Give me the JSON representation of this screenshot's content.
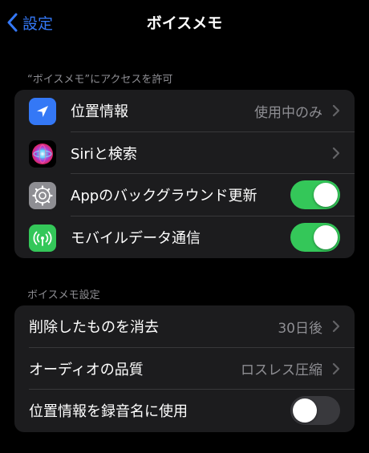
{
  "nav": {
    "back_label": "設定",
    "title": "ボイスメモ"
  },
  "section1": {
    "header": "“ボイスメモ”にアクセスを許可",
    "rows": [
      {
        "label": "位置情報",
        "value": "使用中のみ",
        "icon": "location-arrow-icon",
        "icon_color": "#3478f6",
        "control": "chevron"
      },
      {
        "label": "Siriと検索",
        "value": "",
        "icon": "siri-icon",
        "icon_color": "#000000",
        "control": "chevron"
      },
      {
        "label": "Appのバックグラウンド更新",
        "icon": "gear-icon",
        "icon_color": "#8e8e93",
        "control": "toggle",
        "toggle_on": true
      },
      {
        "label": "モバイルデータ通信",
        "icon": "cellular-antenna-icon",
        "icon_color": "#34c759",
        "control": "toggle",
        "toggle_on": true
      }
    ]
  },
  "section2": {
    "header": "ボイスメモ設定",
    "rows": [
      {
        "label": "削除したものを消去",
        "value": "30日後",
        "control": "chevron"
      },
      {
        "label": "オーディオの品質",
        "value": "ロスレス圧縮",
        "control": "chevron"
      },
      {
        "label": "位置情報を録音名に使用",
        "control": "toggle",
        "toggle_on": false
      }
    ]
  },
  "colors": {
    "accent": "#3478f6",
    "toggle_on": "#34c759",
    "toggle_off": "#39393d",
    "cell_bg": "#1c1c1e",
    "secondary_text": "#8e8e93"
  }
}
